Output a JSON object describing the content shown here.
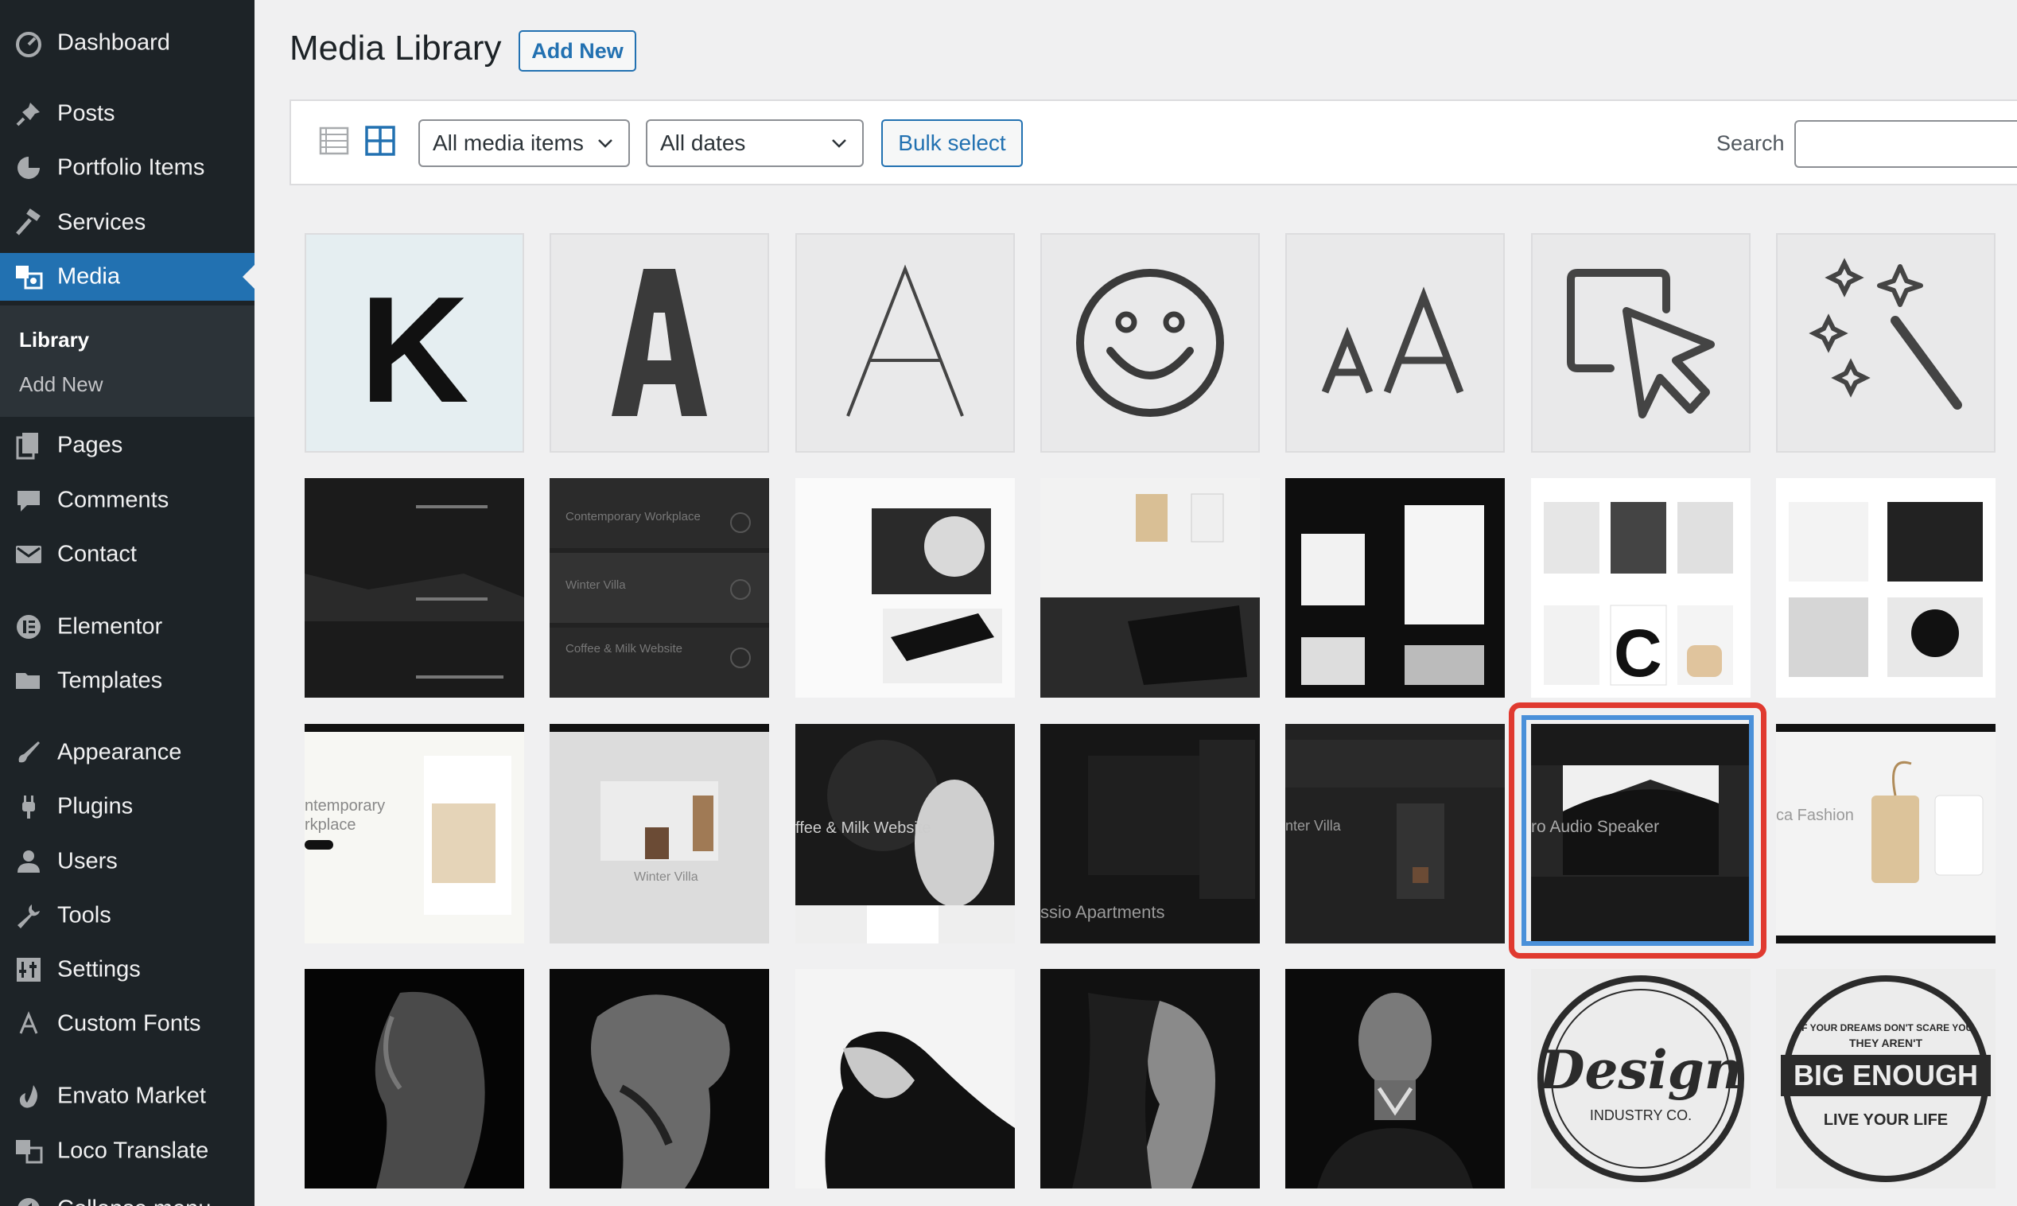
{
  "sidebar": {
    "items": [
      {
        "label": "Dashboard",
        "icon": "dashboard-icon"
      },
      {
        "label": "Posts",
        "icon": "pin-icon"
      },
      {
        "label": "Portfolio Items",
        "icon": "portfolio-icon"
      },
      {
        "label": "Services",
        "icon": "hammer-icon"
      },
      {
        "label": "Media",
        "icon": "media-icon",
        "active": true
      },
      {
        "label": "Pages",
        "icon": "pages-icon"
      },
      {
        "label": "Comments",
        "icon": "comment-icon"
      },
      {
        "label": "Contact",
        "icon": "mail-icon"
      },
      {
        "label": "Elementor",
        "icon": "elementor-icon"
      },
      {
        "label": "Templates",
        "icon": "folder-icon"
      },
      {
        "label": "Appearance",
        "icon": "brush-icon"
      },
      {
        "label": "Plugins",
        "icon": "plug-icon"
      },
      {
        "label": "Users",
        "icon": "user-icon"
      },
      {
        "label": "Tools",
        "icon": "wrench-icon"
      },
      {
        "label": "Settings",
        "icon": "settings-icon"
      },
      {
        "label": "Custom Fonts",
        "icon": "font-icon"
      },
      {
        "label": "Envato Market",
        "icon": "leaf-icon"
      },
      {
        "label": "Loco Translate",
        "icon": "translate-icon"
      },
      {
        "label": "Collapse menu",
        "icon": "collapse-icon"
      }
    ],
    "submenu": [
      {
        "label": "Library",
        "current": true
      },
      {
        "label": "Add New",
        "current": false
      }
    ]
  },
  "header": {
    "title": "Media Library",
    "add_new_label": "Add New"
  },
  "toolbar": {
    "filter_type": "All media items",
    "filter_date": "All dates",
    "bulk_label": "Bulk select",
    "search_label": "Search",
    "search_value": ""
  },
  "grid": {
    "overlays": {
      "t15": "ntemporary",
      "t15b": "rkplace",
      "t16": "Winter Villa",
      "t17": "ffee & Milk Website",
      "t18": "ssio Apartments",
      "t19": "nter Villa",
      "t20": "ro Audio Speaker",
      "t21": "ca Fashion",
      "t8a": "Contemporary Workplace",
      "t8b": "Winter Villa",
      "t8c": "Coffee & Milk Website"
    },
    "logos": {
      "design": "Design",
      "design_sub": "INDUSTRY CO.",
      "big_top": "IF YOUR DREAMS DON'T SCARE YOU",
      "big_mid": "THEY AREN'T",
      "big": "BIG ENOUGH",
      "big_bottom": "LIVE YOUR LIFE"
    },
    "letters": {
      "k": "K",
      "a_bold": "A",
      "a_thin": "A",
      "aa": "AA",
      "c": "C"
    }
  }
}
